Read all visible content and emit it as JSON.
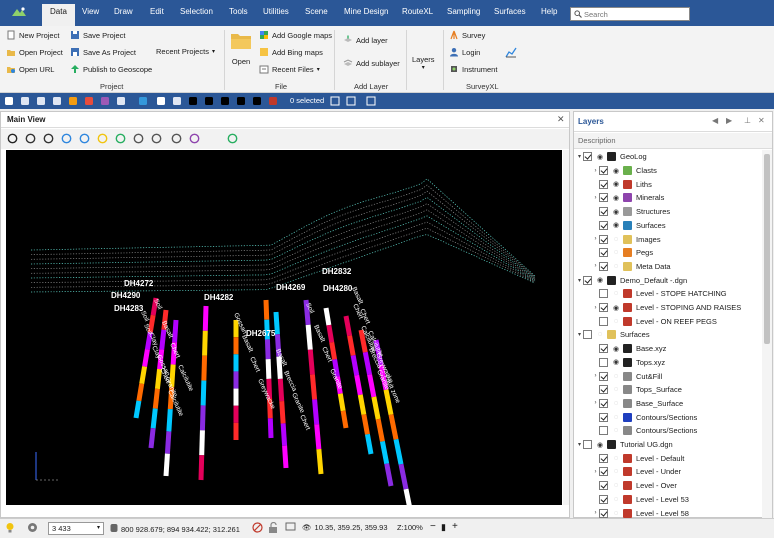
{
  "menu": {
    "items": [
      "Data",
      "View",
      "Draw",
      "Edit",
      "Selection",
      "Tools",
      "Utilities",
      "Scene",
      "Mine Design",
      "RouteXL",
      "Sampling",
      "Surfaces",
      "Help"
    ],
    "active": "Data",
    "search_placeholder": "Search"
  },
  "ribbon": {
    "project": {
      "new_project": "New Project",
      "save_project": "Save Project",
      "open_project": "Open Project",
      "save_as_project": "Save As Project",
      "recent_projects": "Recent Projects",
      "open_url": "Open URL",
      "publish": "Publish to Geoscope",
      "label": "Project"
    },
    "file": {
      "open": "Open",
      "add_google": "Add Google maps",
      "add_bing": "Add Bing maps",
      "recent_files": "Recent Files",
      "label": "File"
    },
    "add_layer": {
      "add_layer": "Add layer",
      "add_sublayer": "Add sublayer",
      "label": "Add Layer"
    },
    "layers": {
      "label": "Layers"
    },
    "surveyxl": {
      "survey": "Survey",
      "login": "Login",
      "instrument": "Instrument",
      "label": "SurveyXL"
    }
  },
  "toolbar": {
    "selected": "0 selected"
  },
  "main_view": {
    "title": "Main View",
    "holes": [
      {
        "label": "DH4272",
        "rocks": [
          "Soil",
          "Basalt",
          "Chert",
          "Calcilutite"
        ]
      },
      {
        "label": "DH4290",
        "rocks": [
          "Soil",
          "Clay",
          "Gossan",
          "Granite"
        ]
      },
      {
        "label": "DH4283",
        "rocks": [
          "Soil",
          "Clay",
          "Chert",
          "Calcilutite"
        ]
      },
      {
        "label": "DH4282",
        "rocks": [
          "Gossan",
          "Basalt",
          "Chert",
          "Greywacke"
        ]
      },
      {
        "label": "DH2675",
        "rocks": [
          "Basalt",
          "Breccia",
          "Granite",
          "Chert"
        ]
      },
      {
        "label": "DH4269",
        "rocks": [
          "Soil",
          "Basalt",
          "Chert",
          "Granite"
        ]
      },
      {
        "label": "DH4280",
        "rocks": [
          "Chert",
          "Calcilutite",
          "Breccia",
          "Granite"
        ]
      },
      {
        "label": "DH2832",
        "rocks": [
          "Basalt",
          "Chert",
          "Calcilutite",
          "Greywacke",
          "Fault zone"
        ]
      }
    ]
  },
  "layers_panel": {
    "title": "Layers",
    "description_header": "Description",
    "rows": [
      {
        "label": "GeoLog",
        "level": 0,
        "expanded": true,
        "checked": true,
        "eye": true,
        "color": "#222222"
      },
      {
        "label": "Clasts",
        "level": 1,
        "checked": true,
        "eye": true,
        "color": "#6ab04c"
      },
      {
        "label": "Liths",
        "level": 1,
        "checked": true,
        "eye": true,
        "color": "#c0392b"
      },
      {
        "label": "Minerals",
        "level": 1,
        "checked": true,
        "eye": true,
        "color": "#8e44ad"
      },
      {
        "label": "Structures",
        "level": 1,
        "checked": true,
        "eye": true,
        "color": "#999999"
      },
      {
        "label": "Surfaces",
        "level": 1,
        "checked": true,
        "eye": true,
        "color": "#2980b9"
      },
      {
        "label": "Images",
        "level": 1,
        "checked": true,
        "eye": false,
        "color": "#e0c15a"
      },
      {
        "label": "Pegs",
        "level": 1,
        "checked": true,
        "eye": false,
        "color": "#e67e22"
      },
      {
        "label": "Meta Data",
        "level": 1,
        "checked": true,
        "eye": false,
        "color": "#e0c15a"
      },
      {
        "label": "Demo_Default -.dgn",
        "level": 0,
        "expanded": true,
        "checked": true,
        "eye": true,
        "color": "#222222"
      },
      {
        "label": "Level - STOPE HATCHING",
        "level": 1,
        "checked": false,
        "eye": false,
        "color": "#c0392b"
      },
      {
        "label": "Level - STOPING AND RAISES",
        "level": 1,
        "checked": true,
        "eye": true,
        "color": "#c0392b"
      },
      {
        "label": "Level - ON REEF PEGS",
        "level": 1,
        "checked": false,
        "eye": false,
        "color": "#c0392b"
      },
      {
        "label": "Surfaces",
        "level": 0,
        "expanded": true,
        "checked": false,
        "eye": false,
        "color": "#e0c15a"
      },
      {
        "label": "Base.xyz",
        "level": 1,
        "checked": true,
        "eye": true,
        "color": "#222222"
      },
      {
        "label": "Tops.xyz",
        "level": 1,
        "checked": false,
        "eye": true,
        "color": "#222222"
      },
      {
        "label": "Cut&Fill",
        "level": 1,
        "checked": true,
        "eye": false,
        "color": "#888888"
      },
      {
        "label": "Tops_Surface",
        "level": 1,
        "checked": true,
        "eye": false,
        "color": "#888888"
      },
      {
        "label": "Base_Surface",
        "level": 1,
        "checked": true,
        "eye": false,
        "color": "#888888"
      },
      {
        "label": "Contours/Sections",
        "level": 1,
        "checked": true,
        "eye": false,
        "color": "#1f3fbf"
      },
      {
        "label": "Contours/Sections",
        "level": 1,
        "checked": false,
        "eye": false,
        "color": "#888888"
      },
      {
        "label": "Tutorial UG.dgn",
        "level": 0,
        "expanded": true,
        "checked": false,
        "eye": true,
        "color": "#222222"
      },
      {
        "label": "Level - Default",
        "level": 1,
        "checked": true,
        "eye": false,
        "color": "#c0392b"
      },
      {
        "label": "Level - Under",
        "level": 1,
        "checked": true,
        "eye": false,
        "color": "#c0392b"
      },
      {
        "label": "Level - Over",
        "level": 1,
        "checked": true,
        "eye": false,
        "color": "#c0392b"
      },
      {
        "label": "Level - Level 53",
        "level": 1,
        "checked": true,
        "eye": false,
        "color": "#c0392b"
      },
      {
        "label": "Level - Level 58",
        "level": 1,
        "checked": true,
        "eye": false,
        "color": "#c0392b"
      }
    ]
  },
  "status_bar": {
    "zoom_value": "3 433",
    "coordinates": "800 928.679; 894 934.422; 312.261",
    "view_angles": "10.35, 359.25, 359.93",
    "zoom_percent": "Z:100%"
  },
  "colors": {
    "accent": "#2b5797",
    "rock_palette": [
      "#e4005a",
      "#ff2a2a",
      "#b300ff",
      "#ff00ff",
      "#ffd500",
      "#ff6a00",
      "#00c8ff",
      "#8a2be2",
      "#ffffff"
    ]
  }
}
